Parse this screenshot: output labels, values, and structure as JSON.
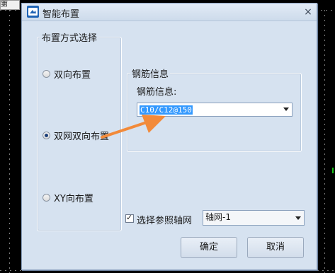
{
  "background": {
    "corner_text": "第"
  },
  "dialog": {
    "title": "智能布置",
    "icon": "app-icon",
    "close_glyph": "×"
  },
  "layout_group": {
    "label": "布置方式选择",
    "options": [
      {
        "label": "双向布置",
        "checked": false
      },
      {
        "label": "双网双向布置",
        "checked": true
      },
      {
        "label": "XY向布置",
        "checked": false
      }
    ]
  },
  "rebar_group": {
    "label": "钢筋信息",
    "field_label": "钢筋信息:",
    "combo_value": "C10/C12@150"
  },
  "axis_grid": {
    "checkbox_label": "选择参照轴网",
    "checked": true,
    "select_value": "轴网-1"
  },
  "buttons": {
    "ok": "确定",
    "cancel": "取消"
  },
  "colors": {
    "dialog_bg": "#d6e2f0",
    "annotation_arrow": "#f28a3a",
    "selection": "#3399ff"
  }
}
